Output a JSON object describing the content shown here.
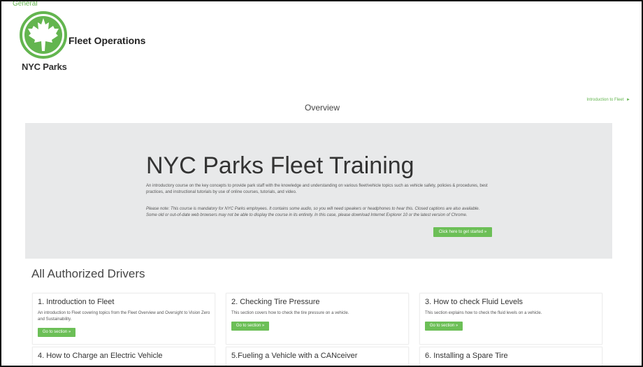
{
  "header": {
    "general_link": "General",
    "app_title": "Fleet Operations",
    "brand_name": "NYC Parks",
    "brand_color": "#63b54f"
  },
  "page": {
    "title": "Overview",
    "next_link": "Introduction to Fleet",
    "next_arrow": "►"
  },
  "hero": {
    "title": "NYC Parks Fleet Training",
    "description": "An introductory course on the key concepts to provide park staff with the knowledge and understanding on various fleet/vehicle topics such as vehicle safety, policies & procedures, best practices, and instructional tutorials by use of online courses, tutorials, and video.",
    "note": "Please note: This course is mandatory for NYC Parks employees. It contains some audio, so you will need speakers or headphones to hear this. Closed captions are also available. Some old or out-of-date web browsers may not be able to display the course in its entirety. In this case, please download Internet Explorer 10 or the latest version of Chrome.",
    "button_label": "Click here to get started »"
  },
  "sections": {
    "heading": "All Authorized Drivers",
    "cards": [
      {
        "title": "1. Introduction to Fleet",
        "description": "An introduction to Fleet covering topics from the Fleet Overview and Oversight to Vision Zero and Sustainability.",
        "button_label": "Go to section »"
      },
      {
        "title": "2. Checking Tire Pressure",
        "description": "This section covers how to check the tire pressure on a vehicle.",
        "button_label": "Go to section »"
      },
      {
        "title": "3. How to check Fluid Levels",
        "description": "This section explains how to check the fluid levels on a vehicle.",
        "button_label": "Go to section »"
      },
      {
        "title": "4. How to Charge an Electric Vehicle"
      },
      {
        "title": "5.Fueling a Vehicle with a CANceiver"
      },
      {
        "title": "6. Installing a Spare Tire"
      }
    ]
  },
  "colors": {
    "accent": "#6cbf57",
    "hero_background": "#e8e9ea"
  }
}
